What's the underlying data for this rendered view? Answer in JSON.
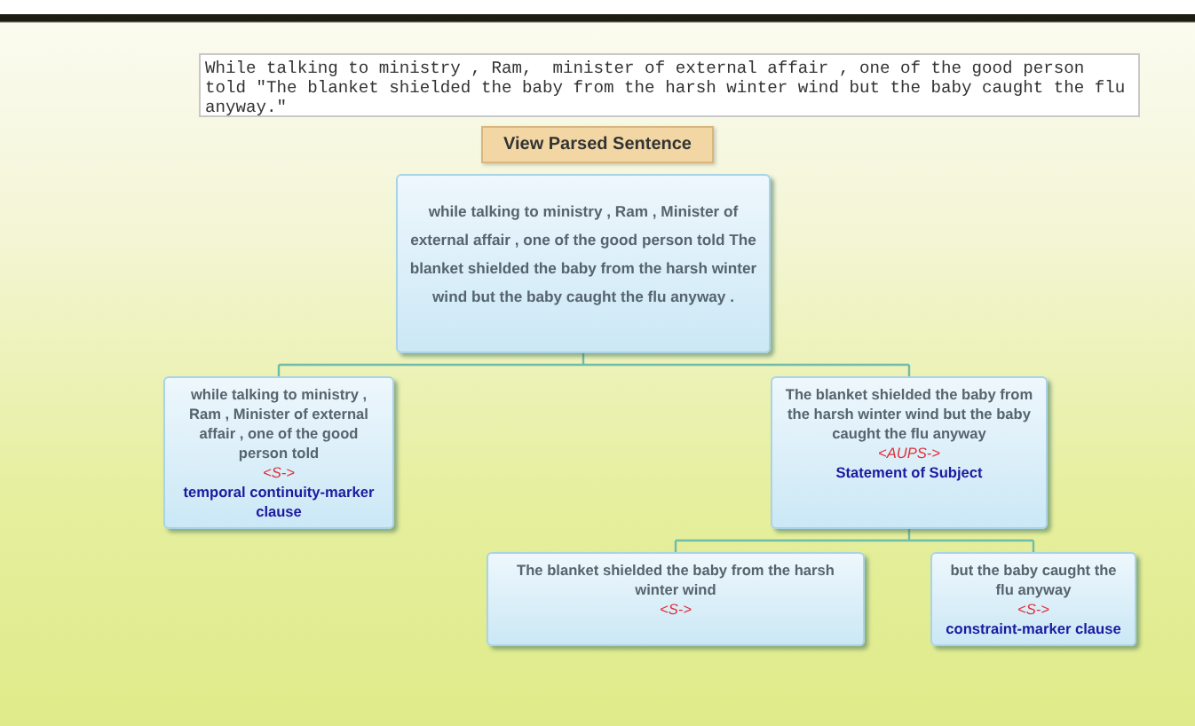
{
  "sentence_field": {
    "value": "While talking to ministry , Ram,  minister of external affair , one of the good person told \"The blanket shielded the baby from the harsh winter wind but the baby caught the flu anyway.\""
  },
  "parse_button": {
    "label": "View Parsed Sentence"
  },
  "parse_tree": {
    "text": "while talking to ministry , Ram , Minister of external affair , one of the good person told The blanket shielded the baby from the harsh winter wind  but the baby caught the flu anyway  .",
    "children": [
      {
        "text": "while talking to ministry , Ram , Minister of external affair , one of the good person told",
        "tag": "<S->",
        "relation": "temporal continuity-marker clause"
      },
      {
        "text": "The blanket shielded the baby from the harsh winter wind  but the baby caught the flu anyway",
        "tag": "<AUPS->",
        "relation": "Statement of Subject",
        "children": [
          {
            "text": "The blanket shielded the baby from the harsh winter wind",
            "tag": "<S->"
          },
          {
            "text": "but the baby caught the flu anyway",
            "tag": "<S->",
            "relation": "constraint-marker clause"
          }
        ]
      }
    ]
  }
}
